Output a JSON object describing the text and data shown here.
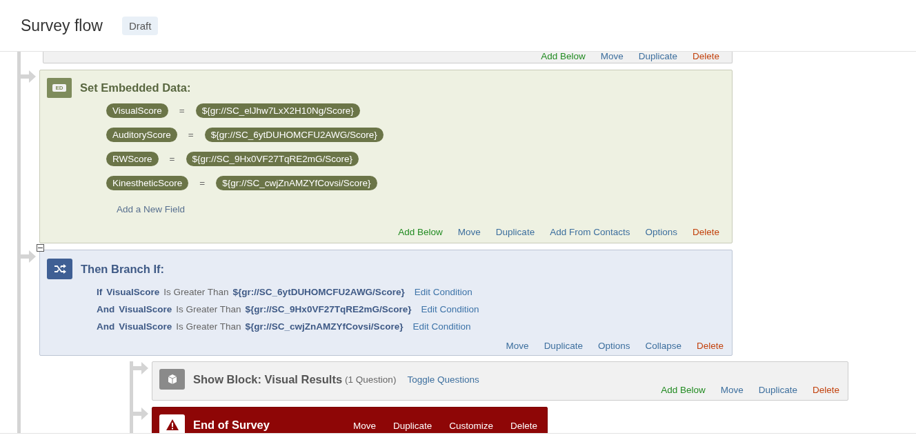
{
  "header": {
    "title": "Survey flow",
    "status": "Draft"
  },
  "flow": [
    {
      "kind": "partial",
      "actions": [
        {
          "label": "Add Below",
          "kind": "add"
        },
        {
          "label": "Move",
          "kind": "plain"
        },
        {
          "label": "Duplicate",
          "kind": "plain"
        },
        {
          "label": "Delete",
          "kind": "delete"
        }
      ]
    },
    {
      "kind": "embedded",
      "title": "Set Embedded Data:",
      "icon_label": "ED",
      "fields": [
        {
          "name": "VisualScore",
          "operator": "=",
          "value": "${gr://SC_elJhw7LxX2H10Ng/Score}"
        },
        {
          "name": "AuditoryScore",
          "operator": "=",
          "value": "${gr://SC_6ytDUHOMCFU2AWG/Score}"
        },
        {
          "name": "RWScore",
          "operator": "=",
          "value": "${gr://SC_9Hx0VF27TqRE2mG/Score}"
        },
        {
          "name": "KinestheticScore",
          "operator": "=",
          "value": "${gr://SC_cwjZnAMZYfCovsi/Score}"
        }
      ],
      "add_field": "Add a New Field",
      "actions": [
        {
          "label": "Add Below",
          "kind": "add"
        },
        {
          "label": "Move",
          "kind": "plain"
        },
        {
          "label": "Duplicate",
          "kind": "plain"
        },
        {
          "label": "Add From Contacts",
          "kind": "plain"
        },
        {
          "label": "Options",
          "kind": "plain"
        },
        {
          "label": "Delete",
          "kind": "delete"
        }
      ]
    },
    {
      "kind": "branch",
      "title": "Then Branch If:",
      "expanded": true,
      "conditions": [
        {
          "conjunction": "If",
          "field": "VisualScore",
          "operator": "Is Greater Than",
          "value": "${gr://SC_6ytDUHOMCFU2AWG/Score}",
          "edit": "Edit Condition"
        },
        {
          "conjunction": "And",
          "field": "VisualScore",
          "operator": "Is Greater Than",
          "value": "${gr://SC_9Hx0VF27TqRE2mG/Score}",
          "edit": "Edit Condition"
        },
        {
          "conjunction": "And",
          "field": "VisualScore",
          "operator": "Is Greater Than",
          "value": "${gr://SC_cwjZnAMZYfCovsi/Score}",
          "edit": "Edit Condition"
        }
      ],
      "actions": [
        {
          "label": "Move",
          "kind": "plain"
        },
        {
          "label": "Duplicate",
          "kind": "plain"
        },
        {
          "label": "Options",
          "kind": "plain"
        },
        {
          "label": "Collapse",
          "kind": "plain"
        },
        {
          "label": "Delete",
          "kind": "delete"
        }
      ],
      "children": [
        {
          "kind": "block",
          "title": "Show Block: Visual Results",
          "count": "(1 Question)",
          "toggle": "Toggle Questions",
          "actions": [
            {
              "label": "Add Below",
              "kind": "add"
            },
            {
              "label": "Move",
              "kind": "plain"
            },
            {
              "label": "Duplicate",
              "kind": "plain"
            },
            {
              "label": "Delete",
              "kind": "delete"
            }
          ]
        },
        {
          "kind": "end",
          "title": "End of Survey",
          "actions": [
            {
              "label": "Move",
              "kind": "plain"
            },
            {
              "label": "Duplicate",
              "kind": "plain"
            },
            {
              "label": "Customize",
              "kind": "plain"
            },
            {
              "label": "Delete",
              "kind": "plain"
            }
          ]
        }
      ]
    }
  ]
}
